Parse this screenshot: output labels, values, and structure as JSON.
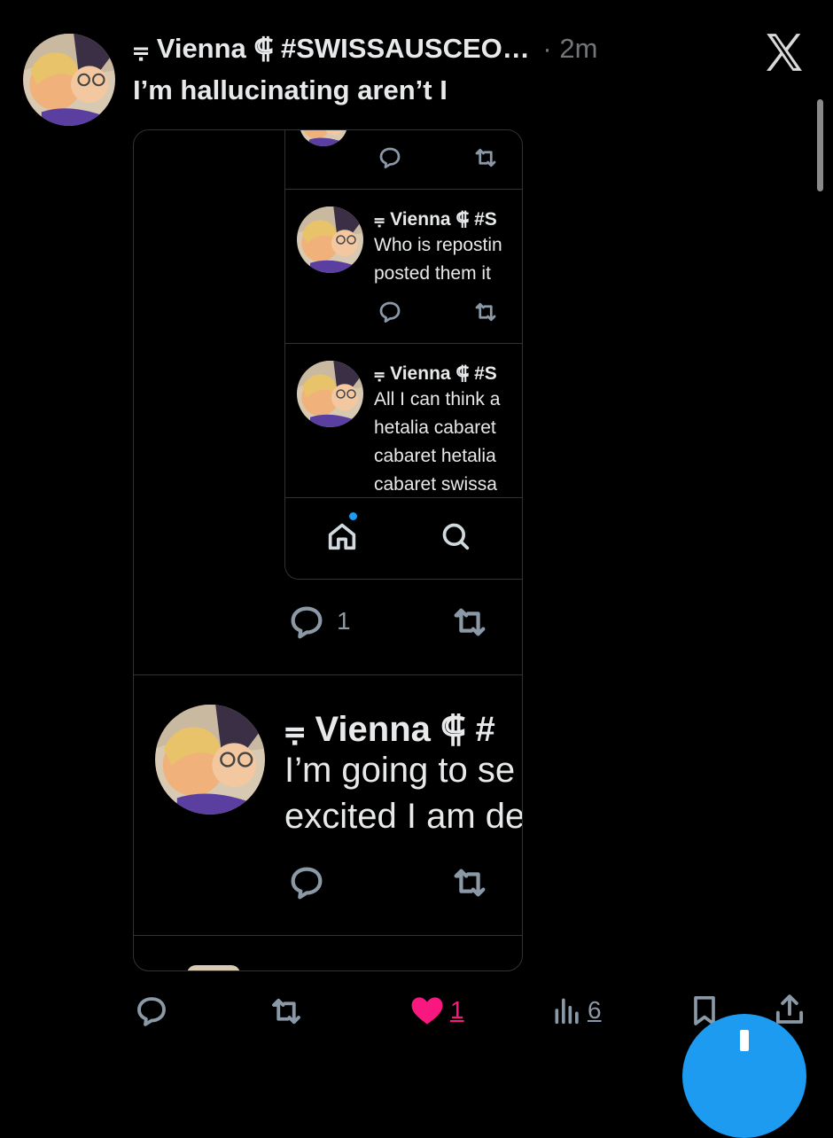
{
  "post": {
    "display_name": "⩦ Vienna ⸿ #SWISSAUSCEO…",
    "time": "· 2m",
    "text": "I’m hallucinating aren’t I"
  },
  "embedded": {
    "tweets": [
      {
        "name": "⩦ Vienna ⸿ #S",
        "lines": [
          "Who is repostin",
          "posted them it"
        ]
      },
      {
        "name": "⩦ Vienna ⸿ #S",
        "lines": [
          "All I can think a",
          "hetalia cabaret",
          "cabaret hetalia",
          "cabaret swissa"
        ]
      }
    ],
    "outer_reply_count": "1",
    "big_tweet": {
      "name": "⩦ Vienna ⸿ #",
      "lines": [
        "I’m going to se",
        "excited I am de"
      ]
    }
  },
  "actions": {
    "like_count": "1",
    "views_count": "6"
  },
  "colors": {
    "like": "#f91880",
    "accent": "#1d9bf0"
  },
  "icons": {
    "logo": "x-logo-icon",
    "reply": "reply-icon",
    "repost": "repost-icon",
    "like": "heart-icon",
    "views": "views-icon",
    "bookmark": "bookmark-icon",
    "share": "share-icon"
  }
}
